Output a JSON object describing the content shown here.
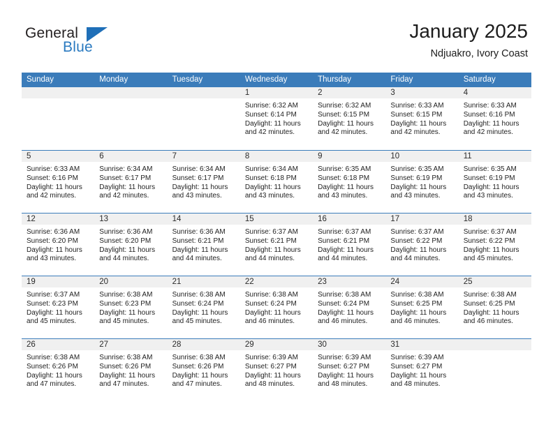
{
  "brand": {
    "name_top": "General",
    "name_bottom": "Blue",
    "accent_color": "#2a7ac0",
    "triangle_color": "#1f6fb8"
  },
  "header": {
    "title": "January 2025",
    "subtitle": "Ndjuakro, Ivory Coast"
  },
  "calendar": {
    "header_bg": "#3b7cba",
    "day_band_bg": "#f0f0f0",
    "weekdays": [
      "Sunday",
      "Monday",
      "Tuesday",
      "Wednesday",
      "Thursday",
      "Friday",
      "Saturday"
    ],
    "weeks": [
      [
        {
          "day": "",
          "sunrise": "",
          "sunset": "",
          "daylight_line1": "",
          "daylight_line2": ""
        },
        {
          "day": "",
          "sunrise": "",
          "sunset": "",
          "daylight_line1": "",
          "daylight_line2": ""
        },
        {
          "day": "",
          "sunrise": "",
          "sunset": "",
          "daylight_line1": "",
          "daylight_line2": ""
        },
        {
          "day": "1",
          "sunrise": "Sunrise: 6:32 AM",
          "sunset": "Sunset: 6:14 PM",
          "daylight_line1": "Daylight: 11 hours",
          "daylight_line2": "and 42 minutes."
        },
        {
          "day": "2",
          "sunrise": "Sunrise: 6:32 AM",
          "sunset": "Sunset: 6:15 PM",
          "daylight_line1": "Daylight: 11 hours",
          "daylight_line2": "and 42 minutes."
        },
        {
          "day": "3",
          "sunrise": "Sunrise: 6:33 AM",
          "sunset": "Sunset: 6:15 PM",
          "daylight_line1": "Daylight: 11 hours",
          "daylight_line2": "and 42 minutes."
        },
        {
          "day": "4",
          "sunrise": "Sunrise: 6:33 AM",
          "sunset": "Sunset: 6:16 PM",
          "daylight_line1": "Daylight: 11 hours",
          "daylight_line2": "and 42 minutes."
        }
      ],
      [
        {
          "day": "5",
          "sunrise": "Sunrise: 6:33 AM",
          "sunset": "Sunset: 6:16 PM",
          "daylight_line1": "Daylight: 11 hours",
          "daylight_line2": "and 42 minutes."
        },
        {
          "day": "6",
          "sunrise": "Sunrise: 6:34 AM",
          "sunset": "Sunset: 6:17 PM",
          "daylight_line1": "Daylight: 11 hours",
          "daylight_line2": "and 42 minutes."
        },
        {
          "day": "7",
          "sunrise": "Sunrise: 6:34 AM",
          "sunset": "Sunset: 6:17 PM",
          "daylight_line1": "Daylight: 11 hours",
          "daylight_line2": "and 43 minutes."
        },
        {
          "day": "8",
          "sunrise": "Sunrise: 6:34 AM",
          "sunset": "Sunset: 6:18 PM",
          "daylight_line1": "Daylight: 11 hours",
          "daylight_line2": "and 43 minutes."
        },
        {
          "day": "9",
          "sunrise": "Sunrise: 6:35 AM",
          "sunset": "Sunset: 6:18 PM",
          "daylight_line1": "Daylight: 11 hours",
          "daylight_line2": "and 43 minutes."
        },
        {
          "day": "10",
          "sunrise": "Sunrise: 6:35 AM",
          "sunset": "Sunset: 6:19 PM",
          "daylight_line1": "Daylight: 11 hours",
          "daylight_line2": "and 43 minutes."
        },
        {
          "day": "11",
          "sunrise": "Sunrise: 6:35 AM",
          "sunset": "Sunset: 6:19 PM",
          "daylight_line1": "Daylight: 11 hours",
          "daylight_line2": "and 43 minutes."
        }
      ],
      [
        {
          "day": "12",
          "sunrise": "Sunrise: 6:36 AM",
          "sunset": "Sunset: 6:20 PM",
          "daylight_line1": "Daylight: 11 hours",
          "daylight_line2": "and 43 minutes."
        },
        {
          "day": "13",
          "sunrise": "Sunrise: 6:36 AM",
          "sunset": "Sunset: 6:20 PM",
          "daylight_line1": "Daylight: 11 hours",
          "daylight_line2": "and 44 minutes."
        },
        {
          "day": "14",
          "sunrise": "Sunrise: 6:36 AM",
          "sunset": "Sunset: 6:21 PM",
          "daylight_line1": "Daylight: 11 hours",
          "daylight_line2": "and 44 minutes."
        },
        {
          "day": "15",
          "sunrise": "Sunrise: 6:37 AM",
          "sunset": "Sunset: 6:21 PM",
          "daylight_line1": "Daylight: 11 hours",
          "daylight_line2": "and 44 minutes."
        },
        {
          "day": "16",
          "sunrise": "Sunrise: 6:37 AM",
          "sunset": "Sunset: 6:21 PM",
          "daylight_line1": "Daylight: 11 hours",
          "daylight_line2": "and 44 minutes."
        },
        {
          "day": "17",
          "sunrise": "Sunrise: 6:37 AM",
          "sunset": "Sunset: 6:22 PM",
          "daylight_line1": "Daylight: 11 hours",
          "daylight_line2": "and 44 minutes."
        },
        {
          "day": "18",
          "sunrise": "Sunrise: 6:37 AM",
          "sunset": "Sunset: 6:22 PM",
          "daylight_line1": "Daylight: 11 hours",
          "daylight_line2": "and 45 minutes."
        }
      ],
      [
        {
          "day": "19",
          "sunrise": "Sunrise: 6:37 AM",
          "sunset": "Sunset: 6:23 PM",
          "daylight_line1": "Daylight: 11 hours",
          "daylight_line2": "and 45 minutes."
        },
        {
          "day": "20",
          "sunrise": "Sunrise: 6:38 AM",
          "sunset": "Sunset: 6:23 PM",
          "daylight_line1": "Daylight: 11 hours",
          "daylight_line2": "and 45 minutes."
        },
        {
          "day": "21",
          "sunrise": "Sunrise: 6:38 AM",
          "sunset": "Sunset: 6:24 PM",
          "daylight_line1": "Daylight: 11 hours",
          "daylight_line2": "and 45 minutes."
        },
        {
          "day": "22",
          "sunrise": "Sunrise: 6:38 AM",
          "sunset": "Sunset: 6:24 PM",
          "daylight_line1": "Daylight: 11 hours",
          "daylight_line2": "and 46 minutes."
        },
        {
          "day": "23",
          "sunrise": "Sunrise: 6:38 AM",
          "sunset": "Sunset: 6:24 PM",
          "daylight_line1": "Daylight: 11 hours",
          "daylight_line2": "and 46 minutes."
        },
        {
          "day": "24",
          "sunrise": "Sunrise: 6:38 AM",
          "sunset": "Sunset: 6:25 PM",
          "daylight_line1": "Daylight: 11 hours",
          "daylight_line2": "and 46 minutes."
        },
        {
          "day": "25",
          "sunrise": "Sunrise: 6:38 AM",
          "sunset": "Sunset: 6:25 PM",
          "daylight_line1": "Daylight: 11 hours",
          "daylight_line2": "and 46 minutes."
        }
      ],
      [
        {
          "day": "26",
          "sunrise": "Sunrise: 6:38 AM",
          "sunset": "Sunset: 6:26 PM",
          "daylight_line1": "Daylight: 11 hours",
          "daylight_line2": "and 47 minutes."
        },
        {
          "day": "27",
          "sunrise": "Sunrise: 6:38 AM",
          "sunset": "Sunset: 6:26 PM",
          "daylight_line1": "Daylight: 11 hours",
          "daylight_line2": "and 47 minutes."
        },
        {
          "day": "28",
          "sunrise": "Sunrise: 6:38 AM",
          "sunset": "Sunset: 6:26 PM",
          "daylight_line1": "Daylight: 11 hours",
          "daylight_line2": "and 47 minutes."
        },
        {
          "day": "29",
          "sunrise": "Sunrise: 6:39 AM",
          "sunset": "Sunset: 6:27 PM",
          "daylight_line1": "Daylight: 11 hours",
          "daylight_line2": "and 48 minutes."
        },
        {
          "day": "30",
          "sunrise": "Sunrise: 6:39 AM",
          "sunset": "Sunset: 6:27 PM",
          "daylight_line1": "Daylight: 11 hours",
          "daylight_line2": "and 48 minutes."
        },
        {
          "day": "31",
          "sunrise": "Sunrise: 6:39 AM",
          "sunset": "Sunset: 6:27 PM",
          "daylight_line1": "Daylight: 11 hours",
          "daylight_line2": "and 48 minutes."
        },
        {
          "day": "",
          "sunrise": "",
          "sunset": "",
          "daylight_line1": "",
          "daylight_line2": ""
        }
      ]
    ]
  }
}
